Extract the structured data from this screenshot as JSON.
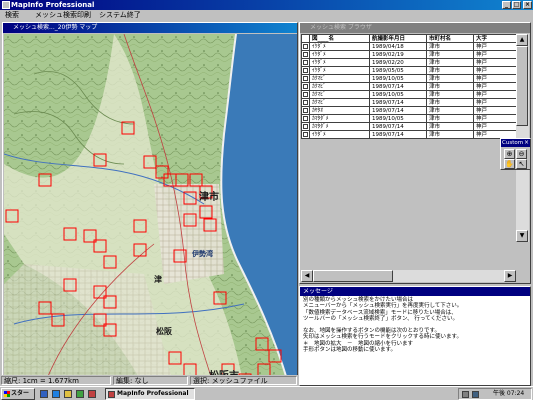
{
  "app": {
    "title": "MapInfo Professional",
    "controls": {
      "minimize": "_",
      "maximize": "□",
      "close": "×"
    }
  },
  "menu": {
    "items": [
      {
        "label": "検索"
      },
      {
        "label": "メッシュ検索"
      },
      {
        "label": "印刷"
      },
      {
        "label": "システム終了"
      }
    ]
  },
  "map_window": {
    "title": "メッシュ検索..._20伊勢 マップ",
    "labels": {
      "city1": "津市",
      "bay": "伊勢湾",
      "city2": "松阪市",
      "place1": "津",
      "place2": "松阪"
    },
    "sea_color": "#3a7ab8",
    "mesh_color": "#ff0000"
  },
  "browser_window": {
    "title": "メッシュ検索 ブラウザ",
    "columns": [
      "図____名",
      "航撮影年月日",
      "市町村名",
      "大字"
    ],
    "rows": [
      [
        "ｲｹﾀﾞﾒ",
        "1989/04/18",
        "津市",
        "神戸"
      ],
      [
        "ｲｹﾀﾞﾒ",
        "1989/02/19",
        "津市",
        "神戸"
      ],
      [
        "ｲｹﾀﾞﾒ",
        "1989/02/20",
        "津市",
        "神戸"
      ],
      [
        "ｲｹﾀﾞﾒ",
        "1989/05/05",
        "津市",
        "神戸"
      ],
      [
        "ｶｸﾏﾋﾞ",
        "1989/10/05",
        "津市",
        "神戸"
      ],
      [
        "ｶｸﾏﾋﾞ",
        "1989/07/14",
        "津市",
        "神戸"
      ],
      [
        "ｶｸﾏﾋﾞ",
        "1989/10/05",
        "津市",
        "神戸"
      ],
      [
        "ｶｸﾏﾋﾞ",
        "1989/07/14",
        "津市",
        "神戸"
      ],
      [
        "ｶﾔﾀｵ",
        "1989/07/14",
        "津市",
        "神戸"
      ],
      [
        "ｶﾏﾀﾀﾞﾒ",
        "1989/10/05",
        "津市",
        "神戸"
      ],
      [
        "ｶﾏﾀﾀﾞﾒ",
        "1989/07/14",
        "津市",
        "神戸"
      ],
      [
        "ｲｹﾀﾞﾒ",
        "1989/07/14",
        "津市",
        "神戸"
      ]
    ]
  },
  "custom_palette": {
    "title": "Custom",
    "tools": [
      {
        "name": "zoom-in",
        "glyph": "⊕"
      },
      {
        "name": "zoom-out",
        "glyph": "⊖"
      },
      {
        "name": "grabber",
        "glyph": "✋"
      },
      {
        "name": "select",
        "glyph": "↖"
      }
    ]
  },
  "message_window": {
    "title": "メッセージ",
    "lines": [
      "別の種類からメッシュ検索をかけたい場合は",
      "メニューバーから「メッシュ検索実行」を再度実行して下さい。",
      "「数値検索データベース流域検索」モードに移りたい場合は、",
      "ツールバーの「メッシュ検索終了」ボタン、 行ってください。",
      "",
      "なお、地図を操作するボタンの機能は次のとおりです。",
      "矢印はメッシュ検索を行うモードをクリックする時に使います。",
      "＊　地図の拡大　－　地図の縮小を行います",
      "手形ボタンは地図の移動に使います。"
    ]
  },
  "status_bar": {
    "scale": "縮尺: 1cm = 1.677km",
    "edit": "編集: なし",
    "select": "選択: メッシュファイル"
  },
  "taskbar": {
    "start": "スタート",
    "task": "MapInfo Professional",
    "clock": "午後 07:24"
  }
}
